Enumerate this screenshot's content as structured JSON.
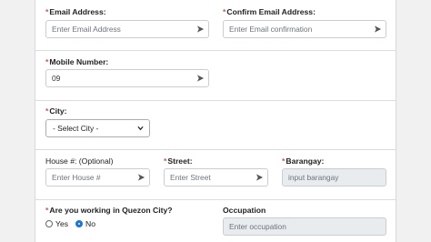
{
  "form": {
    "email": {
      "label": "Email Address:",
      "placeholder": "Enter Email Address",
      "required": "*"
    },
    "confirm_email": {
      "label": "Confirm Email Address:",
      "placeholder": "Enter Email confirmation",
      "required": "*"
    },
    "mobile": {
      "label": "Mobile Number:",
      "value": "09",
      "required": "*"
    },
    "city": {
      "label": "City:",
      "selected": "- Select City -",
      "required": "*"
    },
    "house": {
      "label": "House #: (Optional)",
      "placeholder": "Enter House #"
    },
    "street": {
      "label": "Street:",
      "placeholder": "Enter Street",
      "required": "*"
    },
    "barangay": {
      "label": "Barangay:",
      "placeholder": "input barangay",
      "required": "*"
    },
    "working_qc": {
      "label": "Are you working in Quezon City?",
      "required": "*",
      "options": [
        "Yes",
        "No"
      ],
      "selected": "No"
    },
    "occupation": {
      "label": "Occupation",
      "placeholder": "Enter occupation"
    }
  },
  "colors": {
    "required": "#d9534f",
    "radio_checked": "#1a73e8",
    "disabled_bg": "#e9ecef"
  },
  "icons": {
    "input_autofill": "paper-plane-icon",
    "select_caret": "chevron-down-icon"
  }
}
